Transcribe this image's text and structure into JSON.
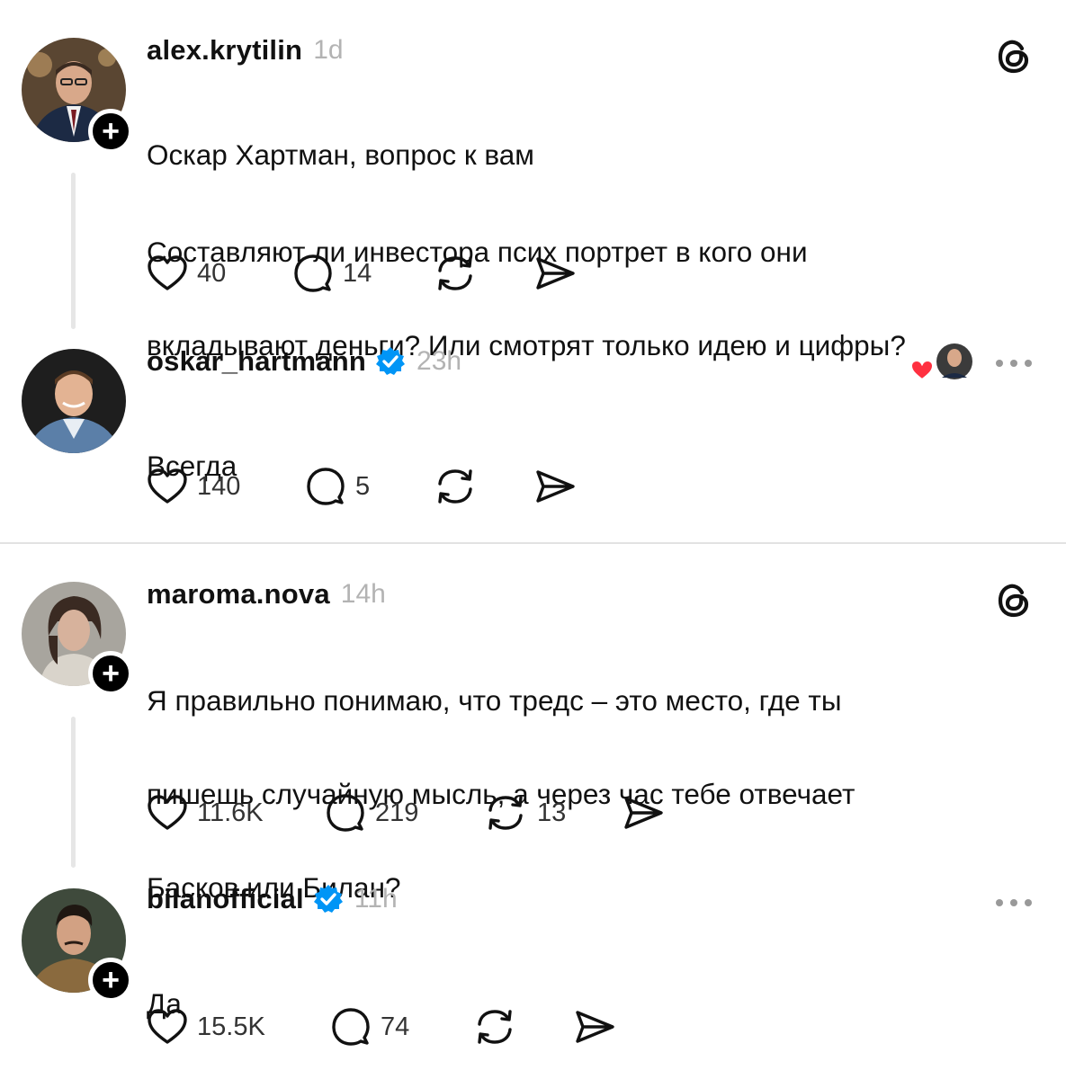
{
  "posts": [
    {
      "username": "alex.krytilin",
      "timestamp": "1d",
      "lines": [
        "Оскар Хартман, вопрос к вам",
        "Составляют ли инвестора псих портрет в кого они",
        "вкладывают деньги? Или смотрят только идею и цифры?"
      ],
      "likes": "40",
      "replies": "14",
      "reposts": "",
      "icons": [
        "heart-icon",
        "comment-icon",
        "repost-icon",
        "share-icon",
        "threads-logo-icon",
        "follow-plus-icon"
      ]
    },
    {
      "username": "oskar_hartmann",
      "timestamp": "23h",
      "verified": true,
      "lines": [
        "Всегда"
      ],
      "likes": "140",
      "replies": "5",
      "reposts": "",
      "icons": [
        "verified-badge-icon",
        "liked-by-author-icon",
        "more-options-icon"
      ]
    },
    {
      "username": "maroma.nova",
      "timestamp": "14h",
      "lines": [
        "Я правильно понимаю, что тредс – это место, где ты",
        "пишешь случайную мысль, а через час тебе отвечает",
        "Басков или Билан?"
      ],
      "likes": "11.6K",
      "replies": "219",
      "reposts": "13",
      "icons": [
        "threads-logo-icon",
        "follow-plus-icon"
      ]
    },
    {
      "username": "bilanofficial",
      "timestamp": "11h",
      "verified": true,
      "lines": [
        "Да"
      ],
      "likes": "15.5K",
      "replies": "74",
      "reposts": "",
      "icons": [
        "verified-badge-icon",
        "more-options-icon",
        "follow-plus-icon"
      ]
    }
  ],
  "colors": {
    "text": "#111111",
    "muted": "#b3b3b3",
    "verified_blue": "#0095f6",
    "like_red": "#ff3040",
    "divider": "#e2e2e2",
    "thread_line": "#e6e6e6"
  }
}
